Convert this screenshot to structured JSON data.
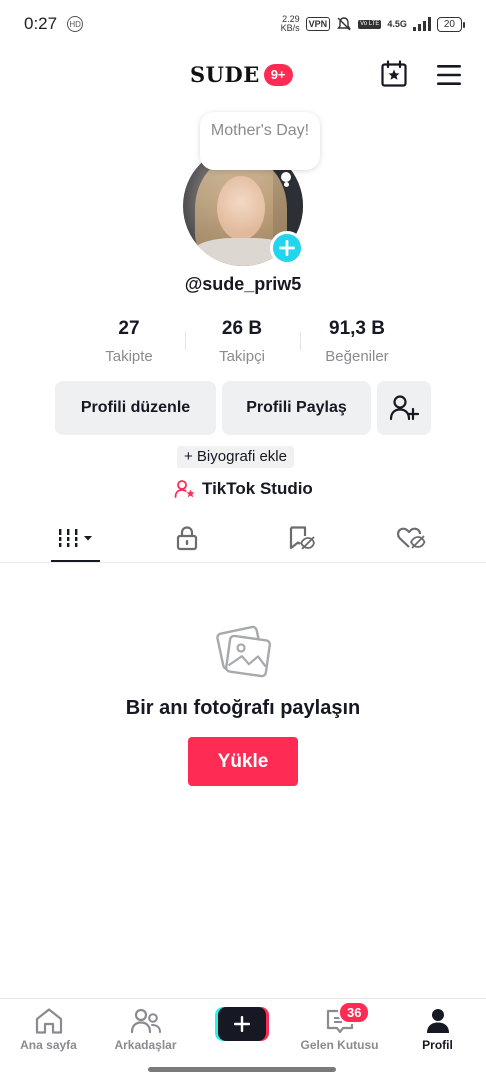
{
  "status_bar": {
    "time": "0:27",
    "speed_value": "2.29",
    "speed_unit": "KB/s",
    "vpn": "VPN",
    "volte": "Vo LTE",
    "network": "4.5G",
    "battery": "20"
  },
  "header": {
    "brand": "SUDE",
    "badge": "9+"
  },
  "profile": {
    "note_bubble": "Mother's Day!",
    "username": "@sude_priw5"
  },
  "stats": [
    {
      "value": "27",
      "label": "Takipte"
    },
    {
      "value": "26 B",
      "label": "Takipçi"
    },
    {
      "value": "91,3 B",
      "label": "Beğeniler"
    }
  ],
  "actions": {
    "edit_profile": "Profili düzenle",
    "share_profile": "Profili Paylaş"
  },
  "bio_button": "+ Biyografi ekle",
  "studio_link": "TikTok Studio",
  "empty_state": {
    "message": "Bir anı fotoğrafı paylaşın",
    "upload_button": "Yükle"
  },
  "bottom_nav": {
    "items": [
      {
        "label": "Ana sayfa",
        "icon": "home-icon"
      },
      {
        "label": "Arkadaşlar",
        "icon": "friends-icon"
      },
      {
        "label": "",
        "icon": "create-plus-icon"
      },
      {
        "label": "Gelen Kutusu",
        "icon": "inbox-icon",
        "badge": "36"
      },
      {
        "label": "Profil",
        "icon": "profile-icon",
        "active": true
      }
    ]
  },
  "colors": {
    "accent": "#fe2c55",
    "cyan": "#20d5ec"
  }
}
